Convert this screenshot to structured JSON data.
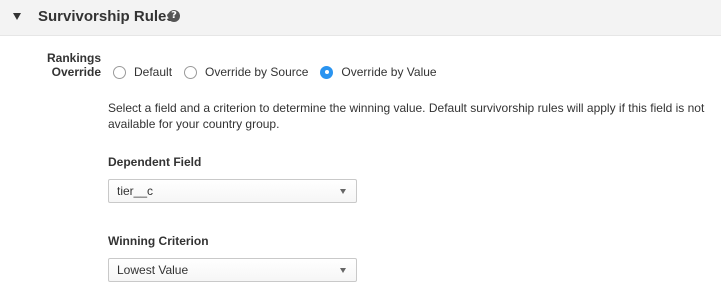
{
  "section": {
    "title": "Survivorship Rules",
    "help_icon": "question-circle-icon",
    "collapse_icon": "caret-down-icon"
  },
  "rankings_override": {
    "label_line1": "Rankings",
    "label_line2": "Override",
    "options": [
      {
        "label": "Default",
        "checked": false
      },
      {
        "label": "Override by Source",
        "checked": false
      },
      {
        "label": "Override by Value",
        "checked": true
      }
    ]
  },
  "description": "Select a field and a criterion to determine the winning value. Default survivorship rules will apply if this field is not available for your country group.",
  "dependent_field": {
    "label": "Dependent Field",
    "value": "tier__c"
  },
  "winning_criterion": {
    "label": "Winning Criterion",
    "value": "Lowest Value"
  },
  "colors": {
    "accent": "#2a94f0",
    "header_bg": "#f3f3f3",
    "text": "#333333"
  }
}
